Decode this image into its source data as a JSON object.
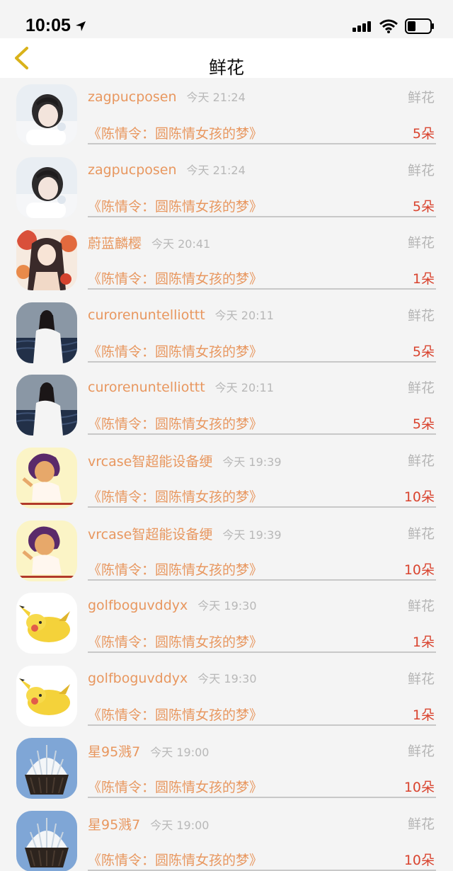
{
  "status_bar": {
    "time": "10:05"
  },
  "nav": {
    "title": "鲜花"
  },
  "rows": [
    {
      "username": "zagpucposen",
      "time": "今天 21:24",
      "type": "鲜花",
      "book": "《陈情令：圆陈情女孩的梦》",
      "count": "5朵",
      "avatar": "sleeping-girl"
    },
    {
      "username": "zagpucposen",
      "time": "今天 21:24",
      "type": "鲜花",
      "book": "《陈情令：圆陈情女孩的梦》",
      "count": "5朵",
      "avatar": "sleeping-girl"
    },
    {
      "username": "蔚蓝麟樱",
      "time": "今天 20:41",
      "type": "鲜花",
      "book": "《陈情令：圆陈情女孩的梦》",
      "count": "1朵",
      "avatar": "anime-girl"
    },
    {
      "username": "curorenuntelliottt",
      "time": "今天 20:11",
      "type": "鲜花",
      "book": "《陈情令：圆陈情女孩的梦》",
      "count": "5朵",
      "avatar": "girl-by-water"
    },
    {
      "username": "curorenuntelliottt",
      "time": "今天 20:11",
      "type": "鲜花",
      "book": "《陈情令：圆陈情女孩的梦》",
      "count": "5朵",
      "avatar": "girl-by-water"
    },
    {
      "username": "vrcase智超能设备绠",
      "time": "今天 19:39",
      "type": "鲜花",
      "book": "《陈情令：圆陈情女孩的梦》",
      "count": "10朵",
      "avatar": "cartoon-lady"
    },
    {
      "username": "vrcase智超能设备绠",
      "time": "今天 19:39",
      "type": "鲜花",
      "book": "《陈情令：圆陈情女孩的梦》",
      "count": "10朵",
      "avatar": "cartoon-lady"
    },
    {
      "username": "golfboguvddyx",
      "time": "今天 19:30",
      "type": "鲜花",
      "book": "《陈情令：圆陈情女孩的梦》",
      "count": "1朵",
      "avatar": "pikachu"
    },
    {
      "username": "golfboguvddyx",
      "time": "今天 19:30",
      "type": "鲜花",
      "book": "《陈情令：圆陈情女孩的梦》",
      "count": "1朵",
      "avatar": "pikachu"
    },
    {
      "username": "星95溅7",
      "time": "今天 19:00",
      "type": "鲜花",
      "book": "《陈情令：圆陈情女孩的梦》",
      "count": "10朵",
      "avatar": "shell-cupcake"
    },
    {
      "username": "星95溅7",
      "time": "今天 19:00",
      "type": "鲜花",
      "book": "《陈情令：圆陈情女孩的梦》",
      "count": "10朵",
      "avatar": "shell-cupcake"
    }
  ],
  "colors": {
    "accent": "#e8975f",
    "count": "#d9442f",
    "muted": "#b8b8b8",
    "back_icon": "#d9b21a"
  }
}
